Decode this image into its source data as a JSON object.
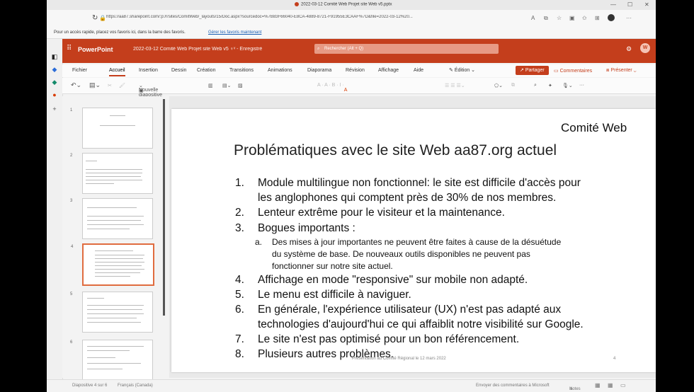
{
  "browser": {
    "window_title": "2022-03-12 Comité Web Projet site Web v5.pptx",
    "url": "https://aa87.sharepoint.com/:p:/r/sites/ComitWeb/_layouts/15/Doc.aspx?sourcedoc=%7B83F66040-E8CA-4889-8721-F91955E3CAAF%7D&file=2022-03-12%20...",
    "favorites_text": "Pour un accès rapide, placez vos favoris ici, dans la barre des favoris.",
    "favorites_link": "Gérer les favoris maintenant"
  },
  "app": {
    "name": "PowerPoint",
    "doc_title": "2022-03-12 Comité Web Projet site Web v5 ♀ᵛ - Enregistré",
    "search_placeholder": "Rechercher (Alt + Q)",
    "user_initial": "W"
  },
  "ribbon": {
    "tabs": [
      "Fichier",
      "Accueil",
      "Insertion",
      "Dessin",
      "Création",
      "Transitions",
      "Animations",
      "Diaporama",
      "Révision",
      "Affichage",
      "Aide"
    ],
    "edit_label": "Édition",
    "share_label": "Partager",
    "comments_label": "Commentaires",
    "present_label": "Présenter",
    "new_slide_label": "Nouvelle diapositive"
  },
  "slide": {
    "corner_label": "Comité Web",
    "title": "Problématiques avec le site Web aa87.org actuel",
    "items": [
      {
        "num": "1.",
        "line1": "Module multilingue non fonctionnel: le site est difficile d'accès pour",
        "line2": "les anglophones qui comptent près de 30% de nos membres."
      },
      {
        "num": "2.",
        "line1": "Lenteur extrême pour le visiteur et la maintenance."
      },
      {
        "num": "3.",
        "line1": "Bogues importants :"
      },
      {
        "num": "4.",
        "line1": "Affichage en mode \"responsive\" sur mobile non adapté."
      },
      {
        "num": "5.",
        "line1": "Le menu est difficile à naviguer."
      },
      {
        "num": "6.",
        "line1": "En générale, l'expérience utilisateur (UX) n'est pas adapté aux",
        "line2": "technologies d'aujourd'hui ce qui affaiblit notre visibilité sur Google."
      },
      {
        "num": "7.",
        "line1": "Le site n'est pas optimisé pour un bon référencement."
      },
      {
        "num": "8.",
        "line1": "Plusieurs autres problèmes."
      }
    ],
    "subitem": {
      "letter": "a.",
      "line1": "Des mises à jour importantes ne peuvent être faites à cause de la désuétude",
      "line2": "du système de base. De nouveaux outils disponibles ne peuvent pas",
      "line3": "fonctionner sur notre site actuel."
    },
    "footer": "Présentation au Comité Régional le 12 mars 2022",
    "page_number": "4"
  },
  "thumbnails": [
    "1",
    "2",
    "3",
    "4",
    "5",
    "6"
  ],
  "status": {
    "slide_info": "Diapositive 4 sur 6",
    "language": "Français (Canada)",
    "feedback": "Envoyer des commentaires à Microsoft",
    "notes": "Notes"
  }
}
